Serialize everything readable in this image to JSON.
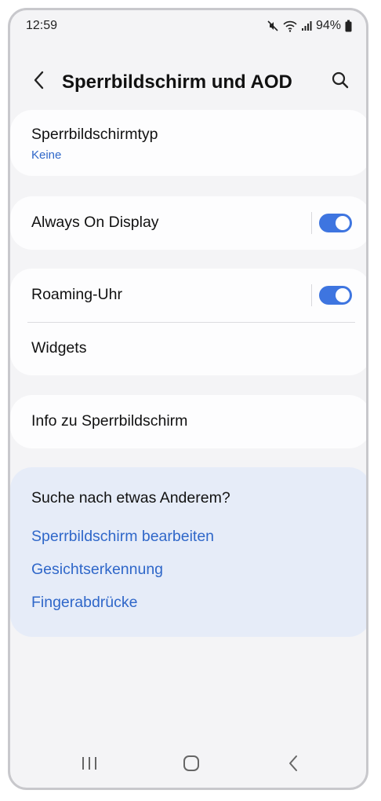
{
  "status_bar": {
    "time": "12:59",
    "battery": "94%",
    "icons": [
      "mute-icon",
      "wifi-icon",
      "signal-icon",
      "battery-icon"
    ]
  },
  "header": {
    "title": "Sperrbildschirm und AOD",
    "back_icon": "chevron-left-icon",
    "search_icon": "search-icon"
  },
  "settings": {
    "lockscreen_type": {
      "title": "Sperrbildschirmtyp",
      "value": "Keine"
    },
    "always_on_display": {
      "title": "Always On Display",
      "enabled": true
    },
    "roaming_clock": {
      "title": "Roaming-Uhr",
      "enabled": true
    },
    "widgets": {
      "title": "Widgets"
    },
    "about": {
      "title": "Info zu Sperrbildschirm"
    }
  },
  "suggestions": {
    "title": "Suche nach etwas Anderem?",
    "links": [
      "Sperrbildschirm bearbeiten",
      "Gesichtserkennung",
      "Fingerabdrücke"
    ]
  },
  "navbar": {
    "icons": [
      "recents-icon",
      "home-icon",
      "back-icon"
    ]
  },
  "colors": {
    "accent": "#3e75e0",
    "link": "#2f67c9",
    "background": "#f4f4f6",
    "card": "#fdfdfe",
    "suggestion_card": "#e6ecf8"
  }
}
